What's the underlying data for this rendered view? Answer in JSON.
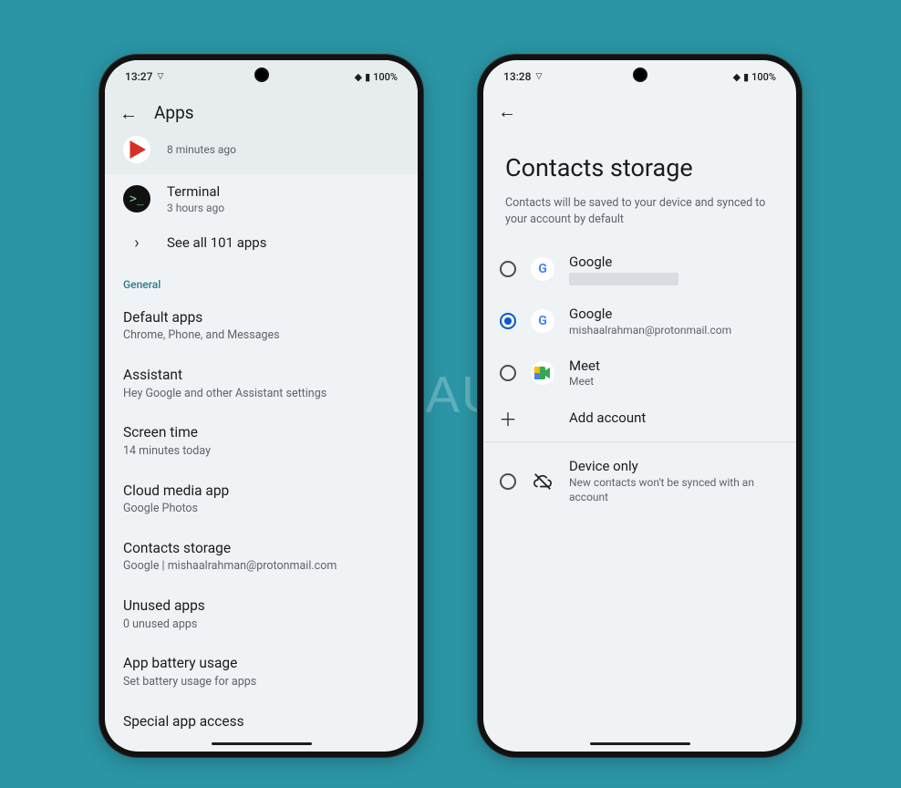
{
  "watermark": "ANDROID AUTHORITY",
  "left": {
    "status_time": "13:27",
    "status_battery": "100%",
    "title": "Apps",
    "partial_sub": "8 minutes ago",
    "terminal": {
      "title": "Terminal",
      "sub": "3 hours ago"
    },
    "see_all": "See all 101 apps",
    "section": "General",
    "items": [
      {
        "title": "Default apps",
        "sub": "Chrome, Phone, and Messages"
      },
      {
        "title": "Assistant",
        "sub": "Hey Google and other Assistant settings"
      },
      {
        "title": "Screen time",
        "sub": "14 minutes today"
      },
      {
        "title": "Cloud media app",
        "sub": "Google Photos"
      },
      {
        "title": "Contacts storage",
        "sub": "Google | mishaalrahman@protonmail.com"
      },
      {
        "title": "Unused apps",
        "sub": "0 unused apps"
      },
      {
        "title": "App battery usage",
        "sub": "Set battery usage for apps"
      },
      {
        "title": "Special app access",
        "sub": ""
      }
    ]
  },
  "right": {
    "status_time": "13:28",
    "status_battery": "100%",
    "title": "Contacts storage",
    "desc": "Contacts will be saved to your device and synced to your account by default",
    "options": [
      {
        "title": "Google",
        "sub_redacted": true,
        "icon": "google",
        "selected": false
      },
      {
        "title": "Google",
        "sub": "mishaalrahman@protonmail.com",
        "icon": "google",
        "selected": true
      },
      {
        "title": "Meet",
        "sub": "Meet",
        "icon": "meet",
        "selected": false
      }
    ],
    "add_account": "Add account",
    "device_only": {
      "title": "Device only",
      "sub": "New contacts won't be synced with an account"
    }
  }
}
